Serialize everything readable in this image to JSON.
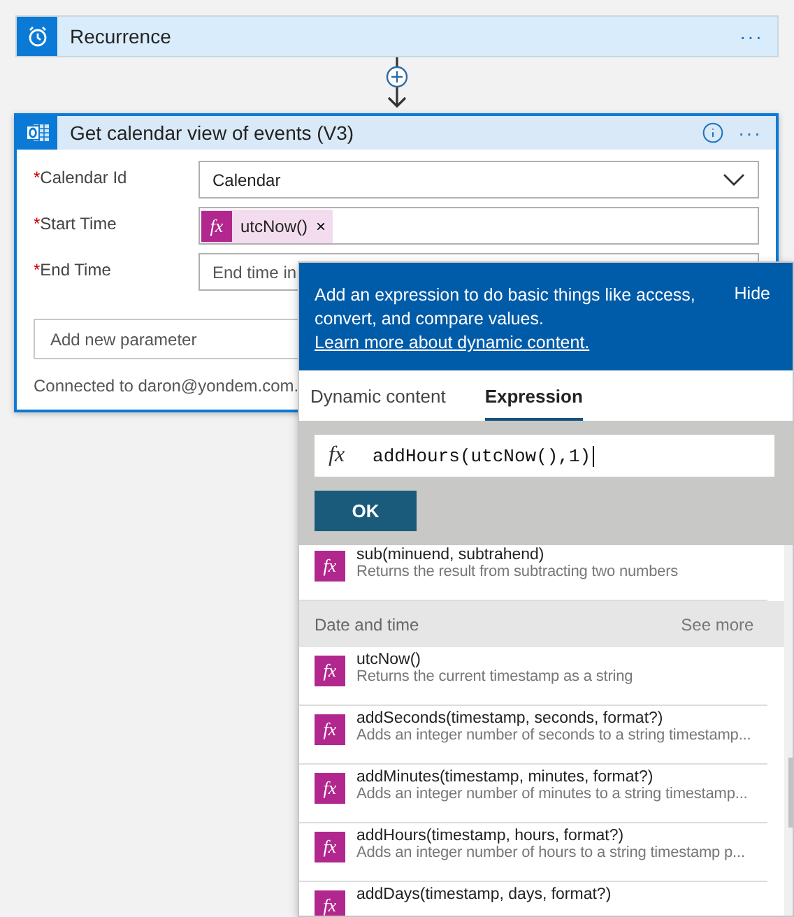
{
  "trigger": {
    "title": "Recurrence",
    "menu": "···"
  },
  "action": {
    "title": "Get calendar view of events (V3)",
    "menu": "···",
    "fields": [
      {
        "kind": "dropdown",
        "required_mark": "*",
        "label": "Calendar Id",
        "value": "Calendar"
      },
      {
        "kind": "token",
        "required_mark": "*",
        "label": "Start Time",
        "token_icon": "fx",
        "token": "utcNow()",
        "remove": "×"
      },
      {
        "kind": "text",
        "required_mark": "*",
        "label": "End Time",
        "placeholder": "End time in"
      }
    ],
    "add_parameter": {
      "placeholder": "Add new parameter"
    },
    "connection": "Connected to daron@yondem.com."
  },
  "popup": {
    "message": "Add an expression to do basic things like access, convert, and compare values.",
    "link": "Learn more about dynamic content.",
    "hide": "Hide",
    "tabs": [
      {
        "label": "Dynamic content",
        "selected": false
      },
      {
        "label": "Expression",
        "selected": true
      }
    ],
    "expression_icon": "fx",
    "expression": "addHours(utcNow(),1)",
    "ok": "OK",
    "items": [
      {
        "kind": "function",
        "icon": "fx",
        "name": "sub(minuend, subtrahend)",
        "description": "Returns the result from subtracting two numbers"
      },
      {
        "kind": "category",
        "name": "Date and time",
        "more": "See more"
      },
      {
        "kind": "function",
        "icon": "fx",
        "name": "utcNow()",
        "description": "Returns the current timestamp as a string"
      },
      {
        "kind": "function",
        "icon": "fx",
        "name": "addSeconds(timestamp, seconds, format?)",
        "description": "Adds an integer number of seconds to a string timestamp..."
      },
      {
        "kind": "function",
        "icon": "fx",
        "name": "addMinutes(timestamp, minutes, format?)",
        "description": "Adds an integer number of minutes to a string timestamp..."
      },
      {
        "kind": "function",
        "icon": "fx",
        "name": "addHours(timestamp, hours, format?)",
        "description": "Adds an integer number of hours to a string timestamp p..."
      },
      {
        "kind": "function",
        "icon": "fx",
        "name": "addDays(timestamp, days, format?)"
      }
    ]
  }
}
